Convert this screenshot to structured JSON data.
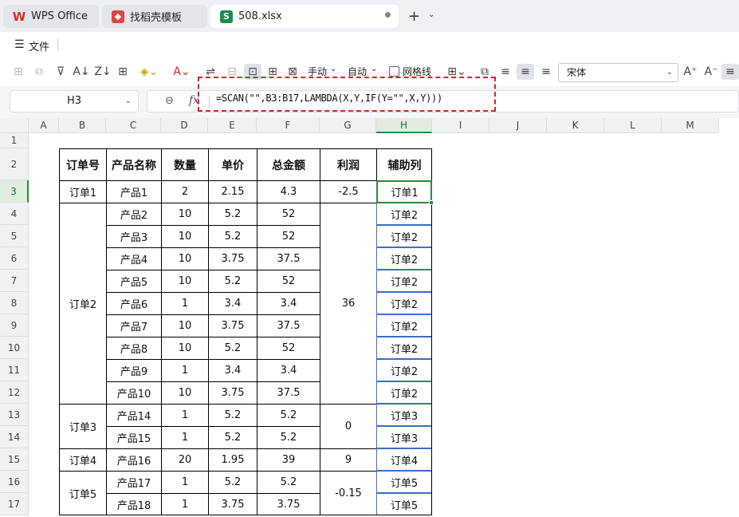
{
  "tabs": [
    {
      "label": "WPS Office",
      "icon": "wps-logo-icon"
    },
    {
      "label": "找稻壳模板",
      "icon": "template-icon"
    },
    {
      "label": "508.xlsx",
      "icon": "spreadsheet-icon"
    }
  ],
  "menu": {
    "file_label": "文件"
  },
  "toolbar": {
    "manual_label": "手动",
    "auto_label": "自动",
    "gridlines_label": "网格线",
    "font_name": "宋体"
  },
  "formula_bar": {
    "cell_ref": "H3",
    "formula": "=SCAN(\"\",B3:B17,LAMBDA(X,Y,IF(Y=\"\",X,Y)))"
  },
  "columns": [
    "A",
    "B",
    "C",
    "D",
    "E",
    "F",
    "G",
    "H",
    "I",
    "J",
    "K",
    "L",
    "M"
  ],
  "rows": [
    "1",
    "2",
    "3",
    "4",
    "5",
    "6",
    "7",
    "8",
    "9",
    "10",
    "11",
    "12",
    "13",
    "14",
    "15",
    "16",
    "17"
  ],
  "table": {
    "headers": [
      "订单号",
      "产品名称",
      "数量",
      "单价",
      "总金额",
      "利润",
      "辅助列"
    ],
    "orders": [
      "订单1",
      "订单2",
      "订单3",
      "订单4",
      "订单5"
    ],
    "profits": [
      "-2.5",
      "36",
      "0",
      "9",
      "-0.15"
    ],
    "rows": [
      {
        "product": "产品1",
        "qty": "2",
        "price": "2.15",
        "total": "4.3",
        "helper": "订单1"
      },
      {
        "product": "产品2",
        "qty": "10",
        "price": "5.2",
        "total": "52",
        "helper": "订单2"
      },
      {
        "product": "产品3",
        "qty": "10",
        "price": "5.2",
        "total": "52",
        "helper": "订单2"
      },
      {
        "product": "产品4",
        "qty": "10",
        "price": "3.75",
        "total": "37.5",
        "helper": "订单2"
      },
      {
        "product": "产品5",
        "qty": "10",
        "price": "5.2",
        "total": "52",
        "helper": "订单2"
      },
      {
        "product": "产品6",
        "qty": "1",
        "price": "3.4",
        "total": "3.4",
        "helper": "订单2"
      },
      {
        "product": "产品7",
        "qty": "10",
        "price": "3.75",
        "total": "37.5",
        "helper": "订单2"
      },
      {
        "product": "产品8",
        "qty": "10",
        "price": "5.2",
        "total": "52",
        "helper": "订单2"
      },
      {
        "product": "产品9",
        "qty": "1",
        "price": "3.4",
        "total": "3.4",
        "helper": "订单2"
      },
      {
        "product": "产品10",
        "qty": "10",
        "price": "3.75",
        "total": "37.5",
        "helper": "订单2"
      },
      {
        "product": "产品14",
        "qty": "1",
        "price": "5.2",
        "total": "5.2",
        "helper": "订单3"
      },
      {
        "product": "产品15",
        "qty": "1",
        "price": "5.2",
        "total": "5.2",
        "helper": "订单3"
      },
      {
        "product": "产品16",
        "qty": "20",
        "price": "1.95",
        "total": "39",
        "helper": "订单4"
      },
      {
        "product": "产品17",
        "qty": "1",
        "price": "5.2",
        "total": "5.2",
        "helper": "订单5"
      },
      {
        "product": "产品18",
        "qty": "1",
        "price": "3.75",
        "total": "3.75",
        "helper": "订单5"
      }
    ]
  },
  "colors": {
    "selection": "#2d8a3e",
    "highlight": "#d9242a",
    "helper_border": "#3b6fc4"
  }
}
